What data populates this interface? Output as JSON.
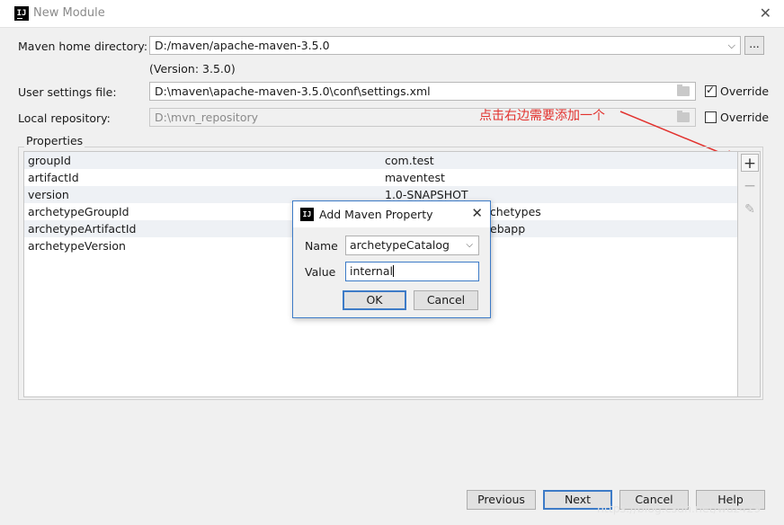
{
  "window": {
    "title": "New Module",
    "logo": "IJ"
  },
  "maven": {
    "home_label": "Maven home directory:",
    "home_value": "D:/maven/apache-maven-3.5.0",
    "version_text": "(Version: 3.5.0)",
    "browse_label": "...",
    "settings_label": "User settings file:",
    "settings_value": "D:\\maven\\apache-maven-3.5.0\\conf\\settings.xml",
    "settings_override_label": "Override",
    "settings_override_checked": true,
    "repo_label": "Local repository:",
    "repo_value": "D:\\mvn_repository",
    "repo_override_label": "Override",
    "repo_override_checked": false
  },
  "annotation": {
    "text": "点击右边需要添加一个",
    "color": "#e2322e"
  },
  "properties": {
    "title": "Properties",
    "rows": [
      {
        "key": "groupId",
        "value": "com.test"
      },
      {
        "key": "artifactId",
        "value": "maventest"
      },
      {
        "key": "version",
        "value": "1.0-SNAPSHOT"
      },
      {
        "key": "archetypeGroupId",
        "value": "rchetypes"
      },
      {
        "key": "archetypeArtifactId",
        "value": "ebapp"
      },
      {
        "key": "archetypeVersion",
        "value": ""
      }
    ],
    "tools": {
      "add": "+",
      "remove": "−",
      "edit": "✎"
    }
  },
  "dialog": {
    "title": "Add Maven Property",
    "logo": "IJ",
    "name_label": "Name",
    "name_value": "archetypeCatalog",
    "value_label": "Value",
    "value_value": "internal",
    "ok_label": "OK",
    "cancel_label": "Cancel"
  },
  "footer": {
    "previous_label": "Previous",
    "next_label": "Next",
    "cancel_label": "Cancel",
    "help_label": "Help"
  },
  "watermark": "https://blog.csdn.net/wuz429",
  "colors": {
    "accent": "#3d7bc7",
    "annotation": "#e2322e",
    "row_alt": "#eef1f5"
  }
}
